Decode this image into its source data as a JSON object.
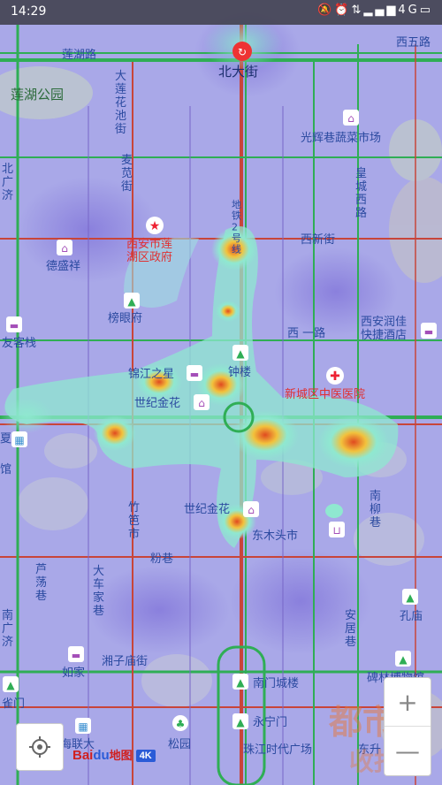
{
  "status_bar": {
    "time": "14:29",
    "network": "4G",
    "icons": [
      "mute-icon",
      "alarm-icon",
      "vibrate-icon",
      "signal-icon",
      "battery-icon"
    ]
  },
  "map": {
    "labels": {
      "lianhu_road": "莲湖路",
      "beidajie": "北大街",
      "xiwu_road": "西五路",
      "lianhu_park": "莲湖公园",
      "dalianhuachi": "大\n莲\n花\n池\n街",
      "guanghui": "光辉巷蔬菜市场",
      "beiyuan": "北\n广\n济",
      "maimiao": "麦\n苋\n街",
      "huangcheng": "皇\n城\n西\n路",
      "metro2": "地\n铁\n2\n号\n线",
      "xixinjie": "西新街",
      "gov": "西安市莲\n湖区政府",
      "desheng": "德盛祥",
      "bangyan": "榜眼府",
      "youke": "友客栈",
      "xian_runjia": "西安润佳\n快捷酒店",
      "xi_yilu": "西  一路",
      "jinjiang": "锦江之星",
      "zhonglou": "钟楼",
      "hospital": "新城区中医医院",
      "century": "世纪金花",
      "century2": "世纪金花",
      "dongmu": "东木头市",
      "zhubashi": "竹\n笆\n市",
      "fenxiang": "粉巷",
      "nanliuxiang": "南\n柳\n巷",
      "lutang": "芦\n荡\n巷",
      "dachaijia": "大\n车\n家\n巷",
      "xiangzimiao": "湘子庙街",
      "rujia": "如家",
      "kongmiao": "孔庙",
      "anjuxiang": "安\n居\n巷",
      "nanmen": "南门城楼",
      "beilin": "碑林博物馆",
      "yongning": "永宁门",
      "songyuan": "松园",
      "zhujiang": "珠江时代广场",
      "haixiang": "海联大",
      "anwhang": "雀门",
      "nanguangji": "南\n广\n济",
      "xia": "夏",
      "guan": "馆",
      "dong": "东升"
    }
  },
  "controls": {
    "zoom_in": "+",
    "zoom_out": "—"
  },
  "logo": {
    "bai": "Bai",
    "du": "du",
    "ditu": "地图",
    "scale": "4K"
  },
  "watermark": "都市 收报",
  "colors": {
    "road_green": "#2fae55",
    "road_red": "#c8453a",
    "heat_low": "#9a8be0",
    "heat_mid": "#7fe6d8",
    "heat_high": "#f0c040",
    "heat_peak": "#e05a2a"
  }
}
